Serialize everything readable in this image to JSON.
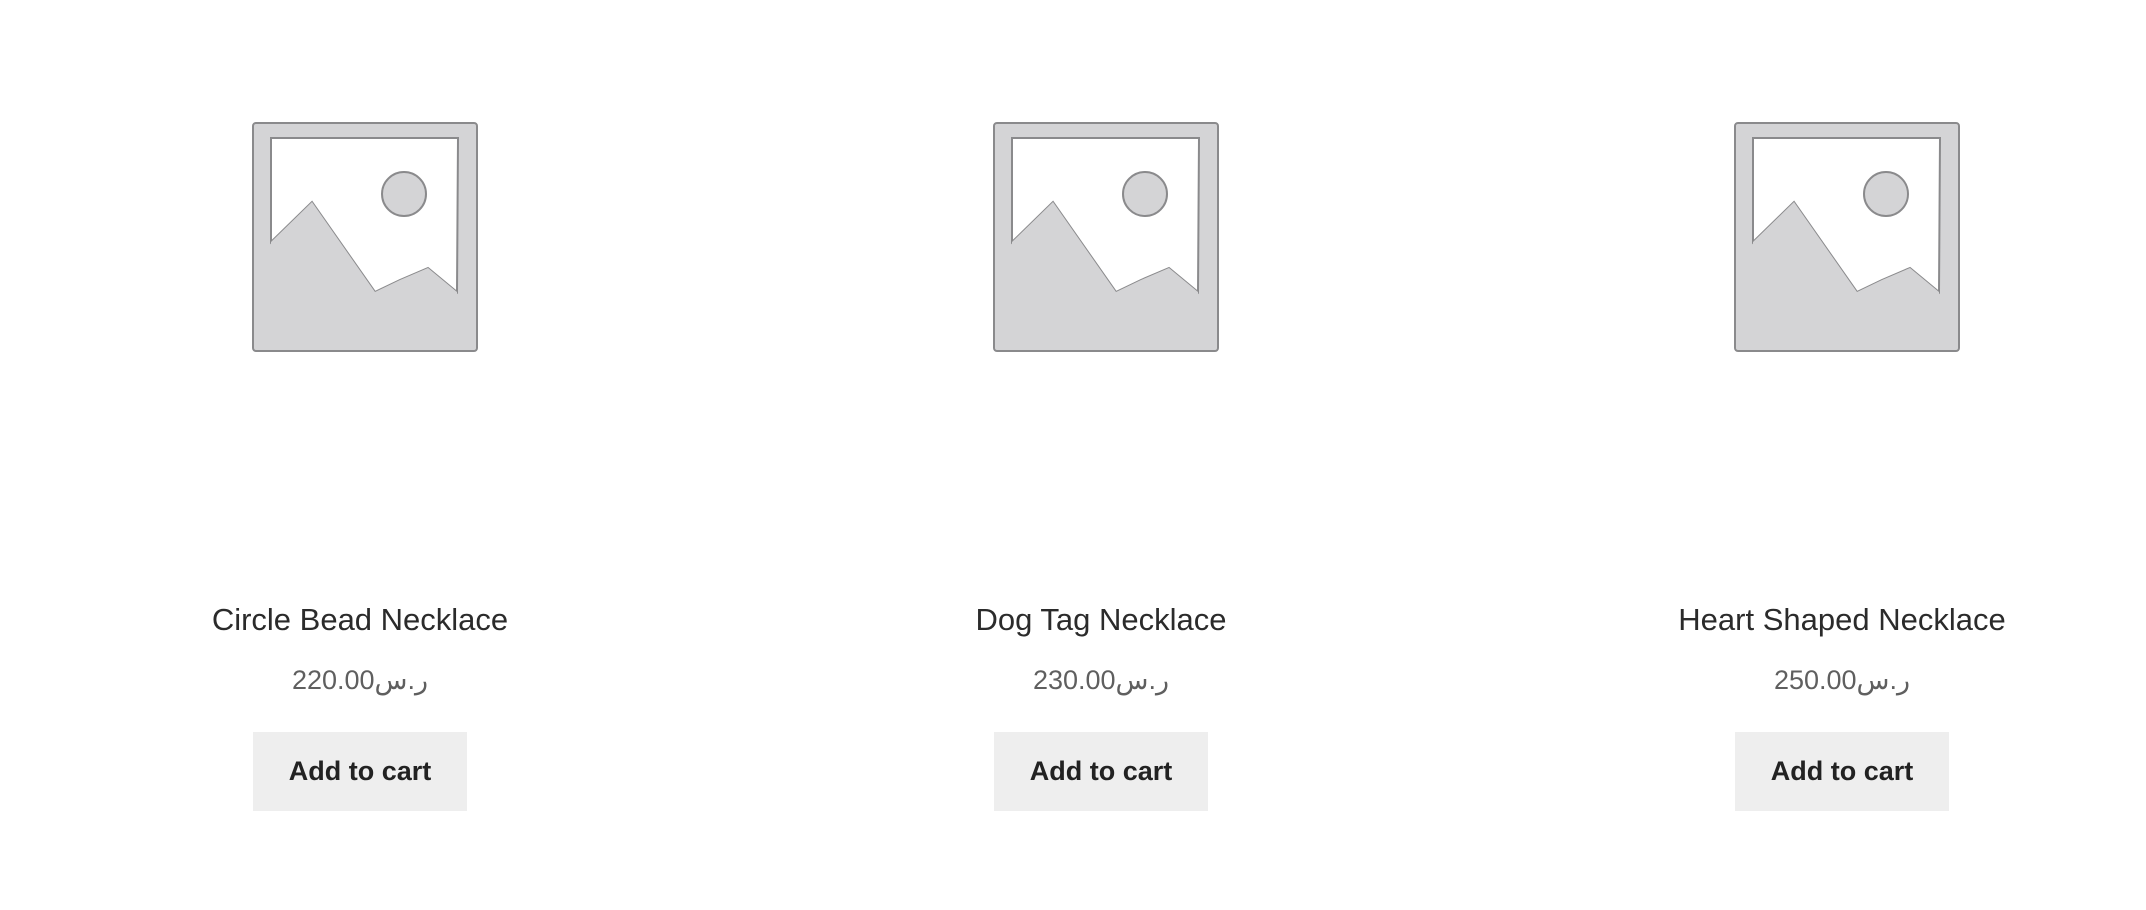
{
  "products": [
    {
      "title": "Circle Bead Necklace",
      "price": "220.00",
      "currency": "ر.س",
      "button_label": "Add to cart",
      "image_icon": "image-placeholder-icon"
    },
    {
      "title": "Dog Tag Necklace",
      "price": "230.00",
      "currency": "ر.س",
      "button_label": "Add to cart",
      "image_icon": "image-placeholder-icon"
    },
    {
      "title": "Heart Shaped Necklace",
      "price": "250.00",
      "currency": "ر.س",
      "button_label": "Add to cart",
      "image_icon": "image-placeholder-icon"
    }
  ],
  "colors": {
    "button_bg": "#eeeeee",
    "title_text": "#2b2b2b",
    "price_text": "#5f5f5f",
    "placeholder_fill": "#d4d4d6",
    "placeholder_stroke": "#8a8a8c"
  }
}
